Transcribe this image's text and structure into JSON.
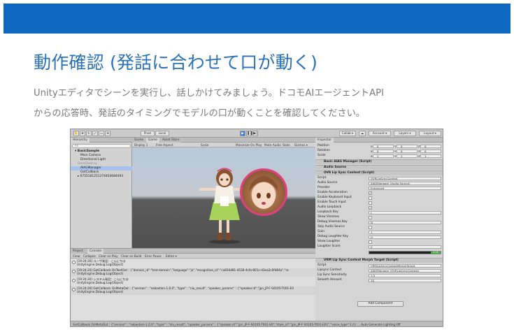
{
  "slide": {
    "title": "動作確認 (発話に合わせて口が動く)",
    "body_line1": "Unityエディタでシーンを実行し、話しかけてみましょう。ドコモAIエージェントAPI",
    "body_line2": "からの応答時、発話のタイミングでモデルの口が動くことを確認してください。",
    "accent_color": "#0d68c0",
    "title_color": "#2a72b8"
  },
  "unity": {
    "toolbar": {
      "pivot": "Pivot",
      "local": "Local",
      "collab": "Collab ▾",
      "account": "Account ▾",
      "layers": "Layers ▾",
      "layout": "Layout ▾"
    },
    "hierarchy": {
      "tab": "Hierarchy",
      "search": "All",
      "rows": [
        "BasicSample",
        "Main Camera",
        "Directional Light",
        "DontDestroy",
        "AIAGManager",
        "GetCallback",
        "6755181251374403684493"
      ]
    },
    "scene": {
      "tabs": [
        "Scene",
        "Game",
        "Asset Store"
      ],
      "display": "Display 1",
      "aspect": "Free Aspect",
      "scale": "Scale",
      "options": [
        "Maximize On Play",
        "Mute Audio",
        "Stats",
        "Gizmos ▾"
      ]
    },
    "inspector": {
      "tab": "Inspector",
      "position_label": "Position",
      "rotation_label": "Rotation",
      "scale_label": "Scale",
      "position": [
        "0",
        "0",
        "0"
      ],
      "rotation": [
        "0",
        "0",
        "0"
      ],
      "scale": [
        "1",
        "1",
        "1"
      ],
      "comp1": "Basic AIAG Manager (Script)",
      "comp2": "Audio Source",
      "comp3": "OVR Lip Sync Context (Script)",
      "fields3": [
        {
          "label": "Script",
          "value": "OVRLipSyncContext"
        },
        {
          "label": "Audio Source",
          "value": "AIAGManager (Audio Source)"
        },
        {
          "label": "Provider",
          "value": "Enhanced"
        },
        {
          "label": "Enable Acceleration",
          "value": "✓"
        },
        {
          "label": "Enable Keyboard Input",
          "value": ""
        },
        {
          "label": "Enable Touch Input",
          "value": ""
        },
        {
          "label": "Audio Loopback",
          "value": "✓"
        },
        {
          "label": "Loopback Key",
          "value": "L"
        },
        {
          "label": "Show Visemes",
          "value": ""
        },
        {
          "label": "Debug Visemes Key",
          "value": "D"
        },
        {
          "label": "Skip Audio Source",
          "value": ""
        },
        {
          "label": "Gain",
          "value": "1"
        },
        {
          "label": "Debug Laughter Key",
          "value": "H"
        },
        {
          "label": "Show Laughter",
          "value": ""
        },
        {
          "label": "Laughter Score",
          "value": "0"
        }
      ],
      "laughter_bar_value": "0.00",
      "comp4": "VRM Lip Sync Context Morph Target (Script)",
      "fields4": [
        {
          "label": "Script",
          "value": "VRMLipSyncContextMorphTarget"
        },
        {
          "label": "Lipsync Context",
          "value": "AIAGManager (OVRLipSyncContext)"
        },
        {
          "label": "Lip Sync Sensitivity",
          "value": "1.5"
        },
        {
          "label": "Smooth Amount",
          "value": "10"
        }
      ],
      "add_component": "Add Component"
    },
    "console": {
      "tabs": [
        "Project",
        "Console"
      ],
      "buttons": [
        "Clear",
        "Collapse",
        "Clear on Play",
        "Clear on Build",
        "Error Pause",
        "Editor ▾"
      ],
      "entries": [
        {
          "line1": "[19:24:20] ユーザ発話：こんにちは",
          "line2": "UnityEngine.Debug:Log(Object)"
        },
        {
          "line1": "[19:24:20] GetCallback OnTextOut : {\"domain_id\":\"test-domain\",\"language\":\"ja\",\"recognition_id\":\"ca834d81-d538-4cfa-801c-d3ea2c0fd84a\",\"re",
          "line2": "UnityEngine.Debug:Log(Object)"
        },
        {
          "line1": "[19:24:20] システム発話：こんにちは",
          "line2": "UnityEngine.Debug:Log(Object)"
        },
        {
          "line1": "[19:24:20] GetCallback OnMetaOut : {\"version\" : \"sebastien-1.0.0\", \"type\" : \"nlu_result\", \"speaker_params\" : {\"speaker.id\":\"jpn_JP-F-S0105-T001-E0",
          "line2": "UnityEngine.Debug:Log(Object)"
        }
      ]
    },
    "status": "GetCallback OnMetaOut : {\"version\" : \"sebastien-1.0.0\", \"type\" : \"nlu_result\", \"speaker_params\" : {\"speaker.id\":\"jpn_JP-F-S0105-T001-E0\",\"style_id\":\"jpn_JP-F-S0105-T001-E01\",\"voice_type\":1.0} ... Auto Generate Lighting Off"
  }
}
